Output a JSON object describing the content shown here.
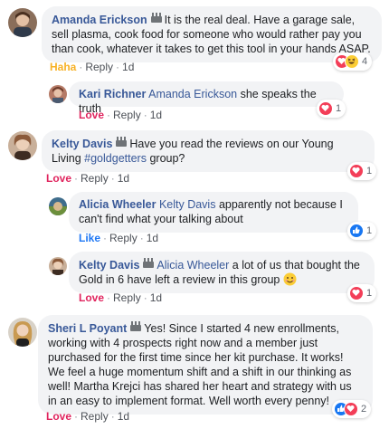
{
  "meta_labels": {
    "reply": "Reply",
    "dot": "·"
  },
  "colors": {
    "author": "#385898",
    "love": "#e0245e",
    "haha": "#f7b125",
    "like": "#2078f4",
    "bubble": "#f2f3f5"
  },
  "comments": [
    {
      "author": "Amanda Erickson",
      "text": "It is the real deal. Have a garage sale, sell plasma, cook food for someone who would rather pay you than cook, whatever it takes to get this tool in your hands ASAP.",
      "reaction_label": "Haha",
      "time": "1d",
      "reaction_icons": [
        "love-icon",
        "haha-icon"
      ],
      "reaction_count": "4"
    },
    {
      "author": "Kari Richner",
      "mention": "Amanda Erickson",
      "text": "she speaks the truth",
      "reaction_label": "Love",
      "time": "1d",
      "reaction_icons": [
        "love-icon"
      ],
      "reaction_count": "1"
    },
    {
      "author": "Kelty Davis",
      "text_before": "Have you read the reviews on our Young Living",
      "hashtag": "#goldgetters",
      "text_after": "group?",
      "reaction_label": "Love",
      "time": "1d",
      "reaction_icons": [
        "love-icon"
      ],
      "reaction_count": "1"
    },
    {
      "author": "Alicia Wheeler",
      "mention": "Kelty Davis",
      "text": "apparently not because I can't find what your talking about",
      "reaction_label": "Like",
      "time": "1d",
      "reaction_icons": [
        "like-icon"
      ],
      "reaction_count": "1"
    },
    {
      "author": "Kelty Davis",
      "mention": "Alicia Wheeler",
      "text": "a lot of us that bought the Gold in 6 have left a review in this group",
      "reaction_label": "Love",
      "time": "1d",
      "reaction_icons": [
        "love-icon"
      ],
      "reaction_count": "1"
    },
    {
      "author": "Sheri L Poyant",
      "text": "Yes! Since I started 4 new enrollments, working with 4 prospects right now and a member just purchased for the first time since her kit purchase. It works! We feel a huge momentum shift and a shift in our thinking as well! Martha Krejci has shared her heart and strategy with us in an easy to implement format. Well worth every penny!",
      "reaction_label": "Love",
      "time": "1d",
      "reaction_icons": [
        "like-icon",
        "love-icon"
      ],
      "reaction_count": "2"
    }
  ]
}
